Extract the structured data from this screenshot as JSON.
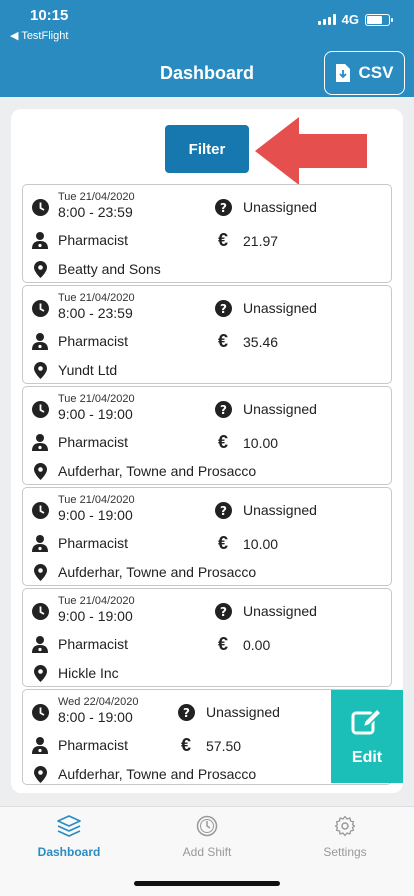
{
  "status_bar": {
    "time": "10:15",
    "back_app": "◀ TestFlight",
    "network": "4G"
  },
  "header": {
    "title": "Dashboard",
    "csv_label": "CSV"
  },
  "filter": {
    "label": "Filter"
  },
  "shifts": [
    {
      "date": "Tue 21/04/2020",
      "time": "8:00 - 23:59",
      "status": "Unassigned",
      "role": "Pharmacist",
      "rate": "21.97",
      "location": "Beatty and Sons"
    },
    {
      "date": "Tue 21/04/2020",
      "time": "8:00 - 23:59",
      "status": "Unassigned",
      "role": "Pharmacist",
      "rate": "35.46",
      "location": "Yundt Ltd"
    },
    {
      "date": "Tue 21/04/2020",
      "time": "9:00 - 19:00",
      "status": "Unassigned",
      "role": "Pharmacist",
      "rate": "10.00",
      "location": "Aufderhar, Towne and Prosacco"
    },
    {
      "date": "Tue 21/04/2020",
      "time": "9:00 - 19:00",
      "status": "Unassigned",
      "role": "Pharmacist",
      "rate": "10.00",
      "location": "Aufderhar, Towne and Prosacco"
    },
    {
      "date": "Tue 21/04/2020",
      "time": "9:00 - 19:00",
      "status": "Unassigned",
      "role": "Pharmacist",
      "rate": "0.00",
      "location": "Hickle Inc"
    },
    {
      "date": "Wed 22/04/2020",
      "time": "8:00 - 19:00",
      "status": "Unassigned",
      "role": "Pharmacist",
      "rate": "57.50",
      "location": "Aufderhar, Towne and Prosacco"
    }
  ],
  "edit_action": {
    "label": "Edit"
  },
  "tabs": [
    {
      "label": "Dashboard",
      "icon": "layers-icon",
      "active": true
    },
    {
      "label": "Add Shift",
      "icon": "clock-icon",
      "active": false
    },
    {
      "label": "Settings",
      "icon": "gear-icon",
      "active": false
    }
  ],
  "colors": {
    "header": "#2a8bc0",
    "filter": "#1778b0",
    "arrow": "#e5504f",
    "edit": "#1cbfb8",
    "active_tab": "#2a8bc0"
  }
}
